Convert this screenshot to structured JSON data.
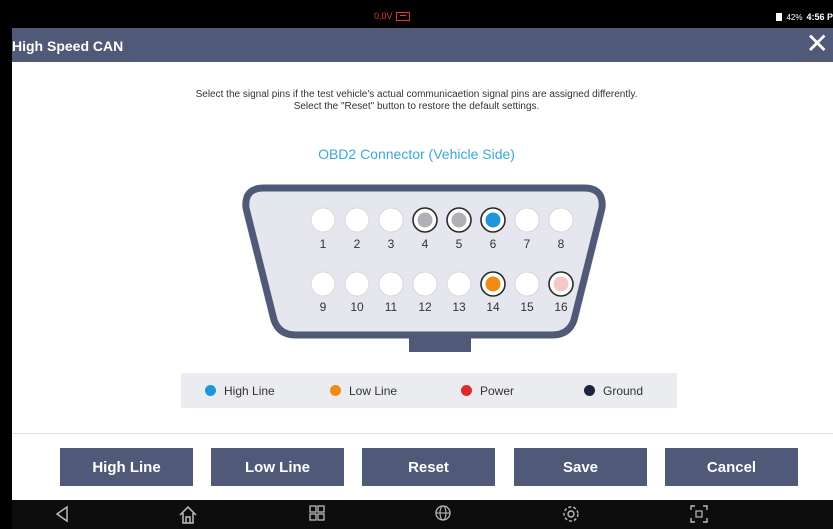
{
  "status": {
    "voltage": "0.0V",
    "battery": "42%",
    "time": "4:56 P"
  },
  "window": {
    "title": "High Speed CAN",
    "close_label": "✕"
  },
  "instructions": {
    "line1": "Select the signal pins if the test vehicle's actual communicaetion signal pins are assigned differently.",
    "line2": "Select the \"Reset\" button to restore the default settings."
  },
  "connector": {
    "title": "OBD2 Connector (Vehicle Side)",
    "top_pins": [
      {
        "label": "1",
        "state": "none"
      },
      {
        "label": "2",
        "state": "none"
      },
      {
        "label": "3",
        "state": "none"
      },
      {
        "label": "4",
        "state": "grey"
      },
      {
        "label": "5",
        "state": "grey"
      },
      {
        "label": "6",
        "state": "high"
      },
      {
        "label": "7",
        "state": "none"
      },
      {
        "label": "8",
        "state": "none"
      }
    ],
    "bottom_pins": [
      {
        "label": "9",
        "state": "none"
      },
      {
        "label": "10",
        "state": "none"
      },
      {
        "label": "11",
        "state": "none"
      },
      {
        "label": "12",
        "state": "none"
      },
      {
        "label": "13",
        "state": "none"
      },
      {
        "label": "14",
        "state": "low"
      },
      {
        "label": "15",
        "state": "none"
      },
      {
        "label": "16",
        "state": "power"
      }
    ]
  },
  "legend": [
    {
      "label": "High Line",
      "color": "#1e96dc"
    },
    {
      "label": "Low Line",
      "color": "#f08c14"
    },
    {
      "label": "Power",
      "color": "#e02a2a"
    },
    {
      "label": "Ground",
      "color": "#1f2540"
    }
  ],
  "colors": {
    "high": "#1e96dc",
    "low": "#f08c14",
    "power_fill": "#f5c8c8",
    "grey": "#b0b0b8",
    "accent": "#505a78",
    "connector_body": "#e6e7ee",
    "connector_border": "#505a78"
  },
  "buttons": {
    "high_line": "High Line",
    "low_line": "Low Line",
    "reset": "Reset",
    "save": "Save",
    "cancel": "Cancel"
  },
  "navbar": {
    "back_icon": "back-icon",
    "home_icon": "home-icon",
    "recent_icon": "recent-apps-icon",
    "browser_icon": "globe-icon",
    "settings_icon": "gear-icon",
    "screenshot_icon": "screenshot-icon"
  }
}
